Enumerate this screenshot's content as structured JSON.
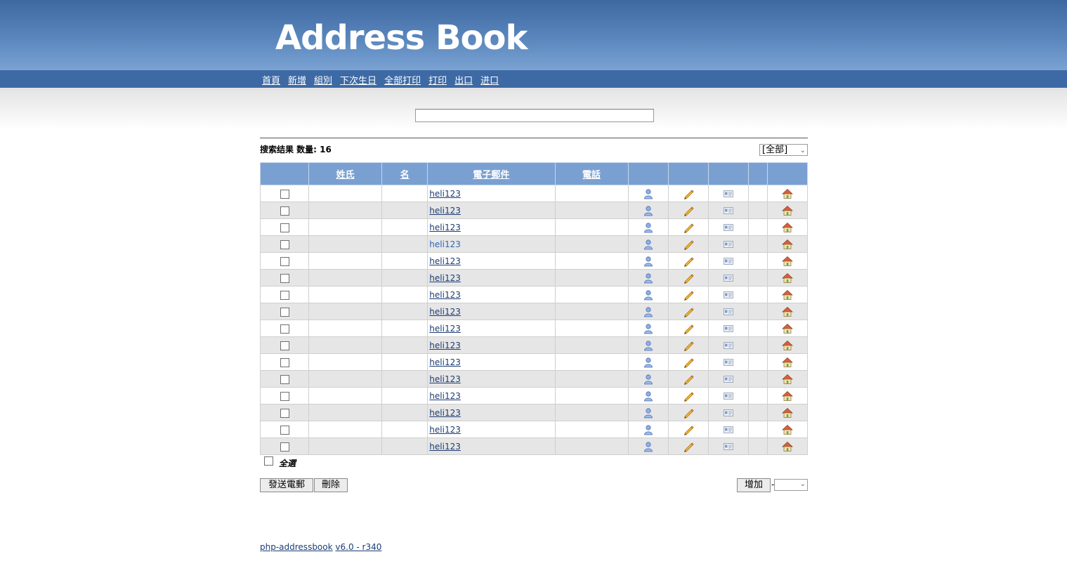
{
  "header": {
    "logo": "Address Book"
  },
  "nav": [
    {
      "label": "首頁"
    },
    {
      "label": "新增"
    },
    {
      "label": "組別"
    },
    {
      "label": "下次生日"
    },
    {
      "label": "全部打印"
    },
    {
      "label": "打印"
    },
    {
      "label": "出口"
    },
    {
      "label": "进口"
    }
  ],
  "search": {
    "value": ""
  },
  "results": {
    "count_label": "搜索结果 数量: 16",
    "group_select": "[全部]"
  },
  "table": {
    "headers": {
      "lastname": "姓氏",
      "firstname": "名",
      "email": "電子郵件",
      "phone": "電話"
    },
    "rows": [
      {
        "lastname": "",
        "firstname": "",
        "email": "heli123",
        "phone": ""
      },
      {
        "lastname": "",
        "firstname": "",
        "email": "heli123",
        "phone": ""
      },
      {
        "lastname": "",
        "firstname": "",
        "email": "heli123",
        "phone": ""
      },
      {
        "lastname": "",
        "firstname": "",
        "email": "heli123",
        "phone": ""
      },
      {
        "lastname": "",
        "firstname": "",
        "email": "heli123",
        "phone": ""
      },
      {
        "lastname": "",
        "firstname": "",
        "email": "heli123",
        "phone": ""
      },
      {
        "lastname": "",
        "firstname": "",
        "email": "heli123",
        "phone": ""
      },
      {
        "lastname": "",
        "firstname": "",
        "email": "heli123",
        "phone": ""
      },
      {
        "lastname": "",
        "firstname": "",
        "email": "heli123",
        "phone": ""
      },
      {
        "lastname": "",
        "firstname": "",
        "email": "heli123",
        "phone": ""
      },
      {
        "lastname": "",
        "firstname": "",
        "email": "heli123",
        "phone": ""
      },
      {
        "lastname": "",
        "firstname": "",
        "email": "heli123",
        "phone": ""
      },
      {
        "lastname": "",
        "firstname": "",
        "email": "heli123",
        "phone": ""
      },
      {
        "lastname": "",
        "firstname": "",
        "email": "heli123",
        "phone": ""
      },
      {
        "lastname": "",
        "firstname": "",
        "email": "heli123",
        "phone": ""
      },
      {
        "lastname": "",
        "firstname": "",
        "email": "heli123",
        "phone": ""
      }
    ],
    "row_icons": [
      "user-details-icon",
      "edit-pencil-icon",
      "vcard-icon",
      "homepage-icon"
    ]
  },
  "select_all_label": "全選",
  "actions": {
    "send_email": "發送電郵",
    "delete": "刪除",
    "add": "增加",
    "dash": "-",
    "add_to_group": ""
  },
  "footer": {
    "app_link": "php-addressbook",
    "version_link": "v6.0 - r340"
  },
  "colors": {
    "header_bg": "#3d6aa4",
    "table_header_bg": "#7aa0d2",
    "row_alt_bg": "#e6e6e6",
    "link": "#1c3c74"
  }
}
